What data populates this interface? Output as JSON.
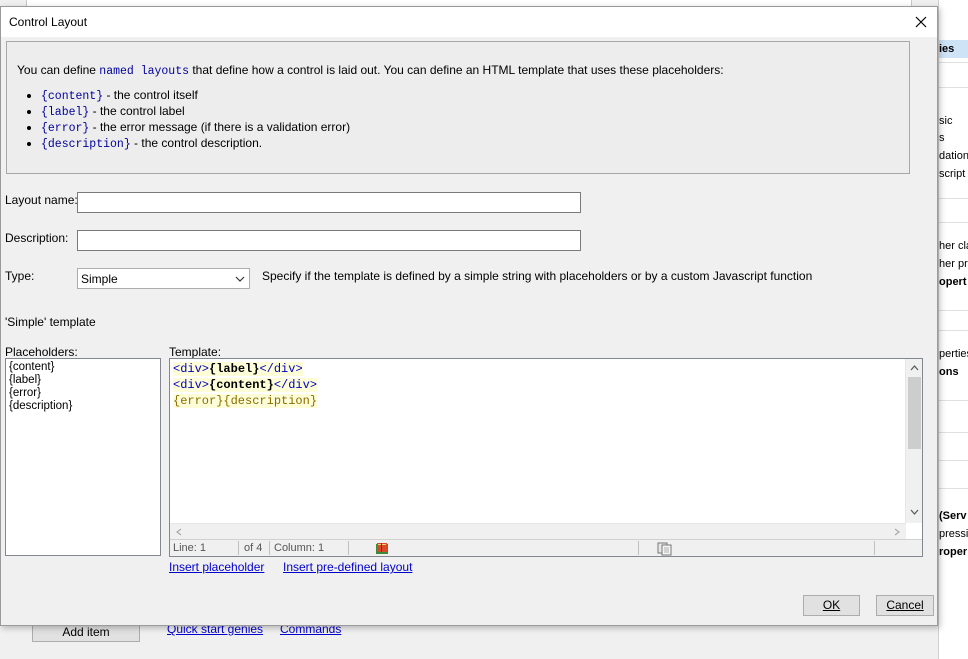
{
  "background": {
    "add_item_label": "Add item",
    "quick_start_label": "Quick start genies",
    "commands_label": "Commands",
    "right_panel_texts": [
      "ies",
      "sic",
      "s",
      "dation",
      "script",
      "her cla",
      "her pre",
      "opert",
      "perties",
      "ons",
      "(Serv",
      "pressio",
      "roper"
    ]
  },
  "dialog": {
    "title": "Control Layout",
    "info": {
      "intro_prefix": "You can define ",
      "intro_keyword": "named layouts",
      "intro_suffix": " that define how a control is laid out. You can define an HTML template that uses these placeholders:",
      "items": [
        {
          "code": "{content}",
          "text": " - the control itself"
        },
        {
          "code": "{label}",
          "text": " - the control label"
        },
        {
          "code": "{error}",
          "text": " - the error message (if there is a validation error)"
        },
        {
          "code": "{description}",
          "text": " - the control description."
        }
      ]
    },
    "layout_name_label": "Layout name:",
    "layout_name_value": "",
    "description_label": "Description:",
    "description_value": "",
    "type_label": "Type:",
    "type_value": "Simple",
    "type_hint": "Specify if the template is defined by a simple string with placeholders or by a custom Javascript function",
    "section_title": "'Simple' template",
    "placeholders_label": "Placeholders:",
    "placeholders": [
      "{content}",
      "{label}",
      "{error}",
      "{description}"
    ],
    "template_label": "Template:",
    "template_lines": [
      {
        "pre": "<div>",
        "ph": "{label}",
        "post": "</div>"
      },
      {
        "pre": "<div>",
        "ph": "{content}",
        "post": "</div>"
      },
      {
        "pre": "",
        "ph": "{error}{description}",
        "post": ""
      }
    ],
    "status": {
      "line": "Line: 1",
      "of": "of 4",
      "column": "Column: 1"
    },
    "insert_placeholder_label": "Insert placeholder",
    "insert_predefined_label": "Insert pre-defined layout",
    "ok_label": "OK",
    "cancel_label": "Cancel"
  },
  "colors": {
    "link": "#0000cc",
    "keyword": "#00009c",
    "template_highlight": "#fdfdd8"
  }
}
